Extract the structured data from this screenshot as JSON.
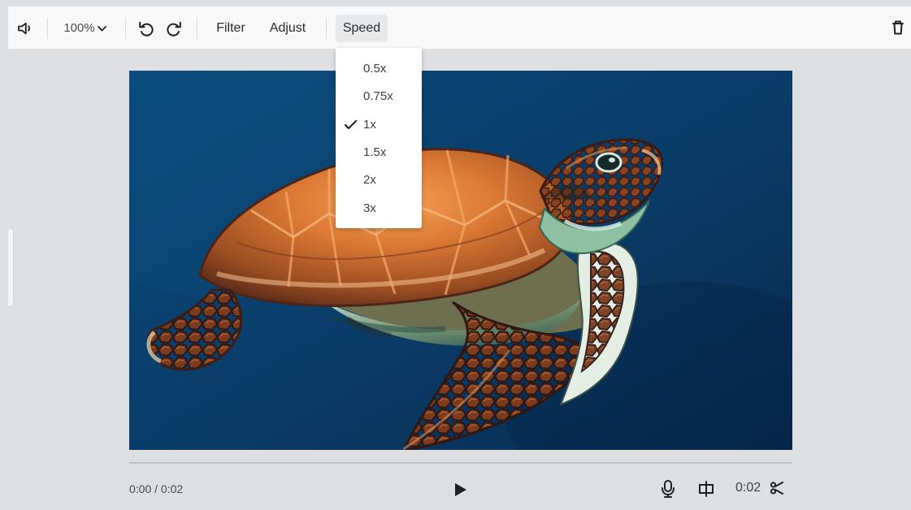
{
  "toolbar": {
    "zoom_value": "100%",
    "filter_label": "Filter",
    "adjust_label": "Adjust",
    "speed_label": "Speed",
    "icons": {
      "volume": "volume-icon",
      "undo": "undo-icon",
      "redo": "redo-icon",
      "delete": "trash-icon",
      "dropdown": "chevron-down-icon"
    }
  },
  "speed_menu": {
    "options": [
      {
        "label": "0.5x",
        "selected": false
      },
      {
        "label": "0.75x",
        "selected": false
      },
      {
        "label": "1x",
        "selected": true
      },
      {
        "label": "1.5x",
        "selected": false
      },
      {
        "label": "2x",
        "selected": false
      },
      {
        "label": "3x",
        "selected": false
      }
    ]
  },
  "video": {
    "subject": "sea turtle",
    "current_time": "0:00 / 0:02",
    "duration": "0:02",
    "progress": 0
  },
  "controls": {
    "icons": {
      "play": "play-icon",
      "microphone": "microphone-icon",
      "frame": "frame-icon",
      "cut": "scissors-icon"
    }
  },
  "colors": {
    "toolbar_background": "#f8f8f9",
    "workspace_background": "#dedfe1",
    "ocean_blue": "#0b3c67",
    "menu_background": "#ffffff"
  }
}
